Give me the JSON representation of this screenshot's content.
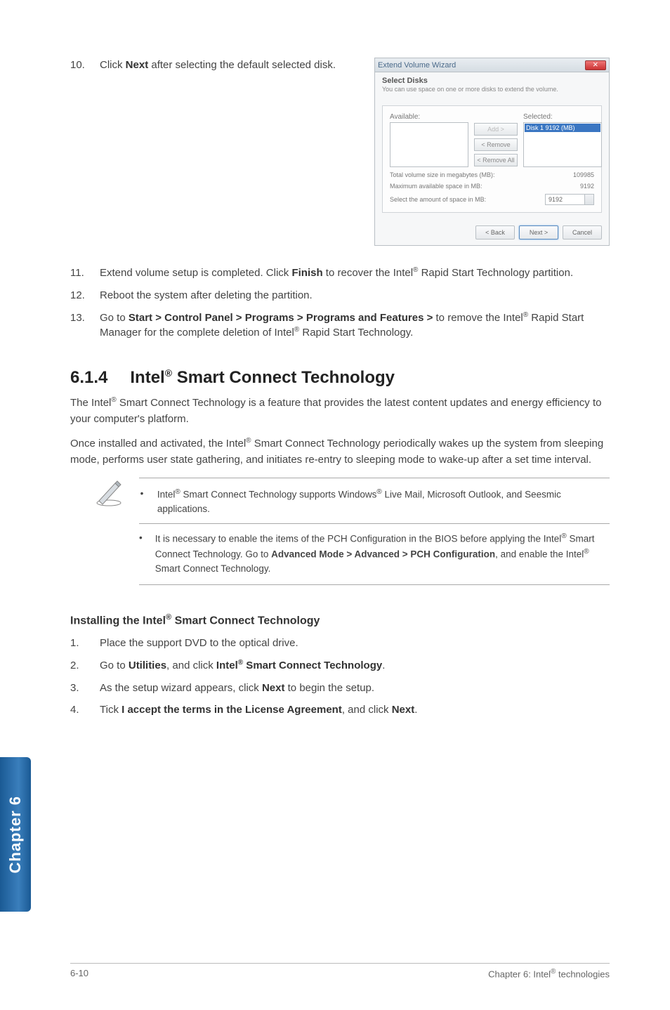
{
  "step10": {
    "num": "10.",
    "text_before": "Click ",
    "bold1": "Next",
    "text_after": " after selecting the default selected disk."
  },
  "dialog": {
    "title": "Extend Volume Wizard",
    "heading": "Select Disks",
    "subheading": "You can use space on one or more disks to extend the volume.",
    "available_label": "Available:",
    "selected_label": "Selected:",
    "selected_item": "Disk 1    9192 (MB)",
    "btn_add": "Add >",
    "btn_remove": "< Remove",
    "btn_remove_all": "< Remove All",
    "row1_label": "Total volume size in megabytes (MB):",
    "row1_val": "109985",
    "row2_label": "Maximum available space in MB:",
    "row2_val": "9192",
    "row3_label": "Select the amount of space in MB:",
    "row3_val": "9192",
    "back": "< Back",
    "next": "Next >",
    "cancel": "Cancel"
  },
  "step11": {
    "num": "11.",
    "p1": "Extend volume setup is completed. Click ",
    "b1": "Finish",
    "p2": " to recover the Intel",
    "p3": " Rapid Start Technology partition."
  },
  "step12": {
    "num": "12.",
    "text": "Reboot the system after deleting the partition."
  },
  "step13": {
    "num": "13.",
    "p1": "Go to ",
    "b1": "Start > Control Panel > Programs > Programs and Features > ",
    "p2": "to remove the Intel",
    "p3": " Rapid Start Manager for the complete deletion of Intel",
    "p4": " Rapid Start Technology."
  },
  "section": {
    "num": "6.1.4",
    "title_pre": "Intel",
    "title_post": " Smart Connect Technology",
    "para1_pre": "The Intel",
    "para1_post": " Smart Connect Technology is a feature that provides the latest content updates and  energy efficiency to your computer's platform.",
    "para2_pre": "Once installed and activated, the Intel",
    "para2_post": " Smart Connect Technology periodically wakes up the system from sleeping mode, performs user state gathering, and initiates re-entry to sleeping mode to wake-up after a set time interval."
  },
  "note": {
    "li1_pre": "Intel",
    "li1_mid": " Smart Connect Technology supports Windows",
    "li1_post": " Live Mail, Microsoft Outlook, and Seesmic applications.",
    "li2_p1": "It is necessary to enable the items of the PCH Configuration in the BIOS before applying the Intel",
    "li2_p2": " Smart Connect Technology. Go to ",
    "li2_b1": "Advanced Mode > Advanced > PCH Configuration",
    "li2_p3": ", and enable the Intel",
    "li2_p4": " Smart Connect Technology."
  },
  "install": {
    "heading_pre": "Installing the Intel",
    "heading_post": " Smart Connect Technology",
    "s1": {
      "num": "1.",
      "text": "Place the support DVD to the optical drive."
    },
    "s2": {
      "num": "2.",
      "p1": "Go to ",
      "b1": "Utilities",
      "p2": ", and click ",
      "b2": "Intel",
      "b2_post": " Smart Connect Technology",
      "p3": "."
    },
    "s3": {
      "num": "3.",
      "p1": "As the setup wizard appears, click ",
      "b1": "Next",
      "p2": " to begin the setup."
    },
    "s4": {
      "num": "4.",
      "p1": "Tick ",
      "b1": "I accept the terms in the License Agreement",
      "p2": ", and click ",
      "b2": "Next",
      "p3": "."
    }
  },
  "sidetab": "Chapter 6",
  "footer": {
    "left": "6-10",
    "right_pre": "Chapter 6: Intel",
    "right_post": " technologies"
  }
}
